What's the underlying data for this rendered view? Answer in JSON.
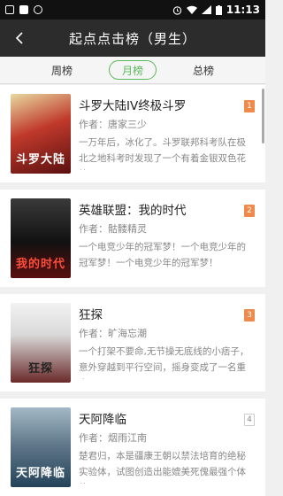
{
  "status_bar": {
    "time": "11:13",
    "left_icons": [
      "notification-square-icon",
      "notification-filled-square-icon",
      "notification-circle-icon"
    ],
    "right_icons": [
      "alarm-icon",
      "wifi-icon",
      "signal-icon",
      "battery-icon"
    ]
  },
  "header": {
    "back_icon": "chevron-left-icon",
    "title": "起点点击榜（男生）"
  },
  "tabs": [
    {
      "label": "周榜",
      "active": false
    },
    {
      "label": "月榜",
      "active": true
    },
    {
      "label": "总榜",
      "active": false
    }
  ],
  "books": [
    {
      "title": "斗罗大陆IV终极斗罗",
      "author": "作者：唐家三少",
      "desc": "一万年后，冰化了。斗罗联邦科考队在极北之地科考时发现了一个有着金银双色花纹...",
      "rank": "1",
      "cover_text": "斗罗大陆",
      "cover_colors": [
        "#c0392b",
        "#e8d9a0"
      ]
    },
    {
      "title": "英雄联盟：我的时代",
      "author": "作者：骷髅精灵",
      "desc": "一个电竞少年的冠军梦！一个电竞少年的冠军梦！一个电竞少年的冠军梦！",
      "rank": "2",
      "cover_text": "我的时代",
      "cover_colors": [
        "#1a1a1a",
        "#c0392b"
      ]
    },
    {
      "title": "狂探",
      "author": "作者：旷海忘潮",
      "desc": "一个打架不要命,无节操无底线的小痞子，意外穿越到平行空间，摇身变成了一名重案...",
      "rank": "3",
      "cover_text": "狂探",
      "cover_colors": [
        "#e9e9e9",
        "#8a2a2a"
      ]
    },
    {
      "title": "天阿降临",
      "author": "作者：烟雨江南",
      "desc": "楚君归，本是疆康王朝以禁法培育的绝秘实验体，试图创造出能媲美死傀最强个体的...",
      "rank": "4",
      "cover_text": "天阿降临",
      "cover_colors": [
        "#24435a",
        "#a3b8c6"
      ]
    }
  ],
  "colors": {
    "accent_green": "#5cb85c",
    "rank_badge": "#f08a4b",
    "header_bg": "#2c2c2c"
  }
}
